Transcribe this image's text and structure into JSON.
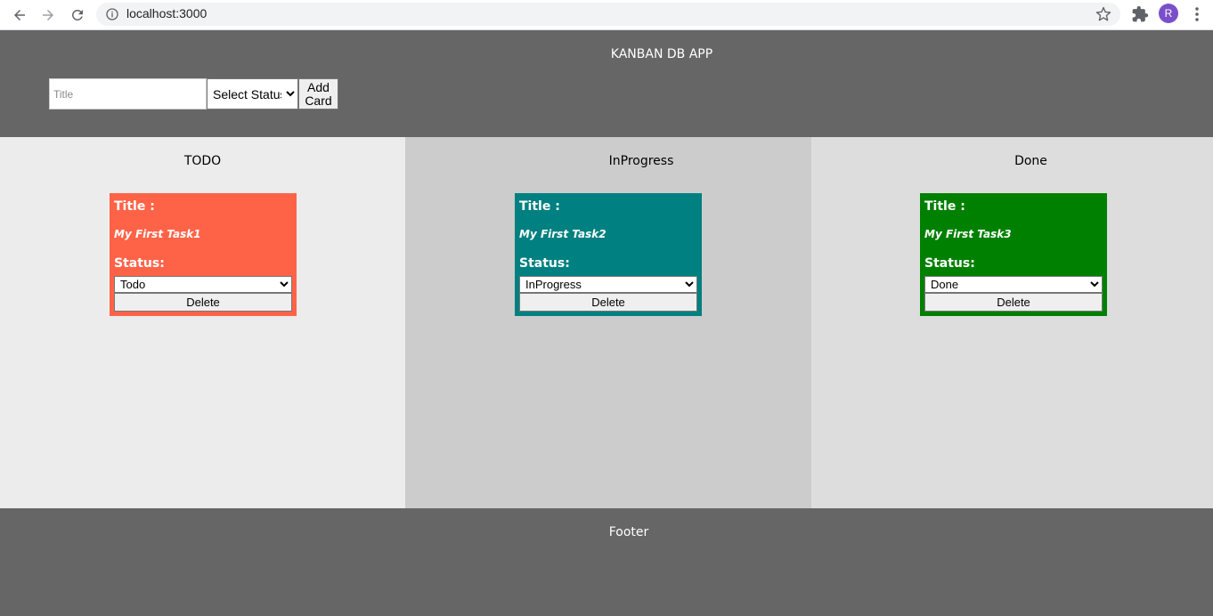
{
  "browser": {
    "url": "localhost:3000",
    "avatar_letter": "R"
  },
  "header": {
    "title": "KANBAN DB APP",
    "title_placeholder": "Title",
    "status_select": "Select Status",
    "add_button": "Add Card"
  },
  "columns": [
    {
      "name": "TODO",
      "background": "#ececec",
      "card": {
        "color": "#ff6347",
        "title_label": "Title :",
        "title": "My First Task1",
        "status_label": "Status:",
        "status": "Todo",
        "delete_label": "Delete"
      }
    },
    {
      "name": "InProgress",
      "background": "#cccccc",
      "card": {
        "color": "#008080",
        "title_label": "Title :",
        "title": "My First Task2",
        "status_label": "Status:",
        "status": "InProgress",
        "delete_label": "Delete"
      }
    },
    {
      "name": "Done",
      "background": "#dddddd",
      "card": {
        "color": "#008000",
        "title_label": "Title :",
        "title": "My First Task3",
        "status_label": "Status:",
        "status": "Done",
        "delete_label": "Delete"
      }
    }
  ],
  "footer": {
    "text": "Footer"
  }
}
